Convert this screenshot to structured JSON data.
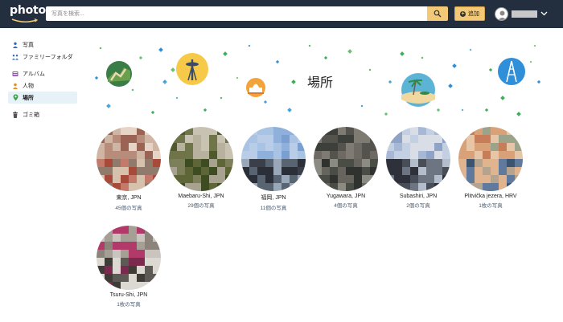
{
  "header": {
    "logo_text": "photos",
    "search_placeholder": "写真を検索...",
    "add_label": "追加",
    "accent_color": "#f3c978",
    "bar_color": "#232f3e"
  },
  "sidebar": {
    "items": [
      {
        "label": "写真",
        "icon": "person-icon"
      },
      {
        "label": "ファミリーフォルダ",
        "icon": "family-icon"
      },
      {
        "label": "アルバム",
        "icon": "album-icon"
      },
      {
        "label": "人物",
        "icon": "people-icon"
      },
      {
        "label": "場所",
        "icon": "location-pin-icon",
        "active": true
      },
      {
        "label": "ゴミ箱",
        "icon": "trash-icon"
      }
    ]
  },
  "banner": {
    "title": "場所"
  },
  "places": [
    {
      "name": "東京, JPN",
      "count": "45個の写真",
      "palette": [
        "#e6d5c6",
        "#cfb6a4",
        "#b88c7a",
        "#9a6354",
        "#c47a6b",
        "#a84a3a",
        "#d6c1ad",
        "#8f7a6c"
      ]
    },
    {
      "name": "Maebaru-Shi, JPN",
      "count": "29個の写真",
      "palette": [
        "#c8c2b2",
        "#b7b19e",
        "#6f7548",
        "#4e5a2c",
        "#3e4d21",
        "#5e6637",
        "#a8a290",
        "#7d7f5a"
      ]
    },
    {
      "name": "福岡, JPN",
      "count": "11個の写真",
      "palette": [
        "#a9c3e4",
        "#8fb0da",
        "#7a9fd0",
        "#b9cde8",
        "#3a3f4a",
        "#2b2f38",
        "#9aa7b8",
        "#596473"
      ]
    },
    {
      "name": "Yugawara, JPN",
      "count": "4個の写真",
      "palette": [
        "#6e6a63",
        "#55534d",
        "#3d3f3a",
        "#7f7b72",
        "#4a4d45",
        "#8b8a83",
        "#2f322e",
        "#66645c"
      ]
    },
    {
      "name": "Subashiri, JPN",
      "count": "2個の写真",
      "palette": [
        "#c3cfe3",
        "#a7b8d6",
        "#8ea3c6",
        "#d8dde6",
        "#2e3139",
        "#494d57",
        "#b4bdcc",
        "#6d7482"
      ]
    },
    {
      "name": "Plitvička jezera, HRV",
      "count": "1枚の写真",
      "palette": [
        "#e7c6a8",
        "#d9a178",
        "#c77d57",
        "#9ba38a",
        "#5f7a9c",
        "#3d5470",
        "#b3a38f",
        "#e0b48f"
      ]
    },
    {
      "name": "Tsuru-Shi, JPN",
      "count": "1枚の写真",
      "palette": [
        "#c9c4bd",
        "#a69f96",
        "#8c847a",
        "#b23a6a",
        "#7a2a4c",
        "#5d5a55",
        "#dcd8d2",
        "#3f3c38"
      ]
    }
  ]
}
